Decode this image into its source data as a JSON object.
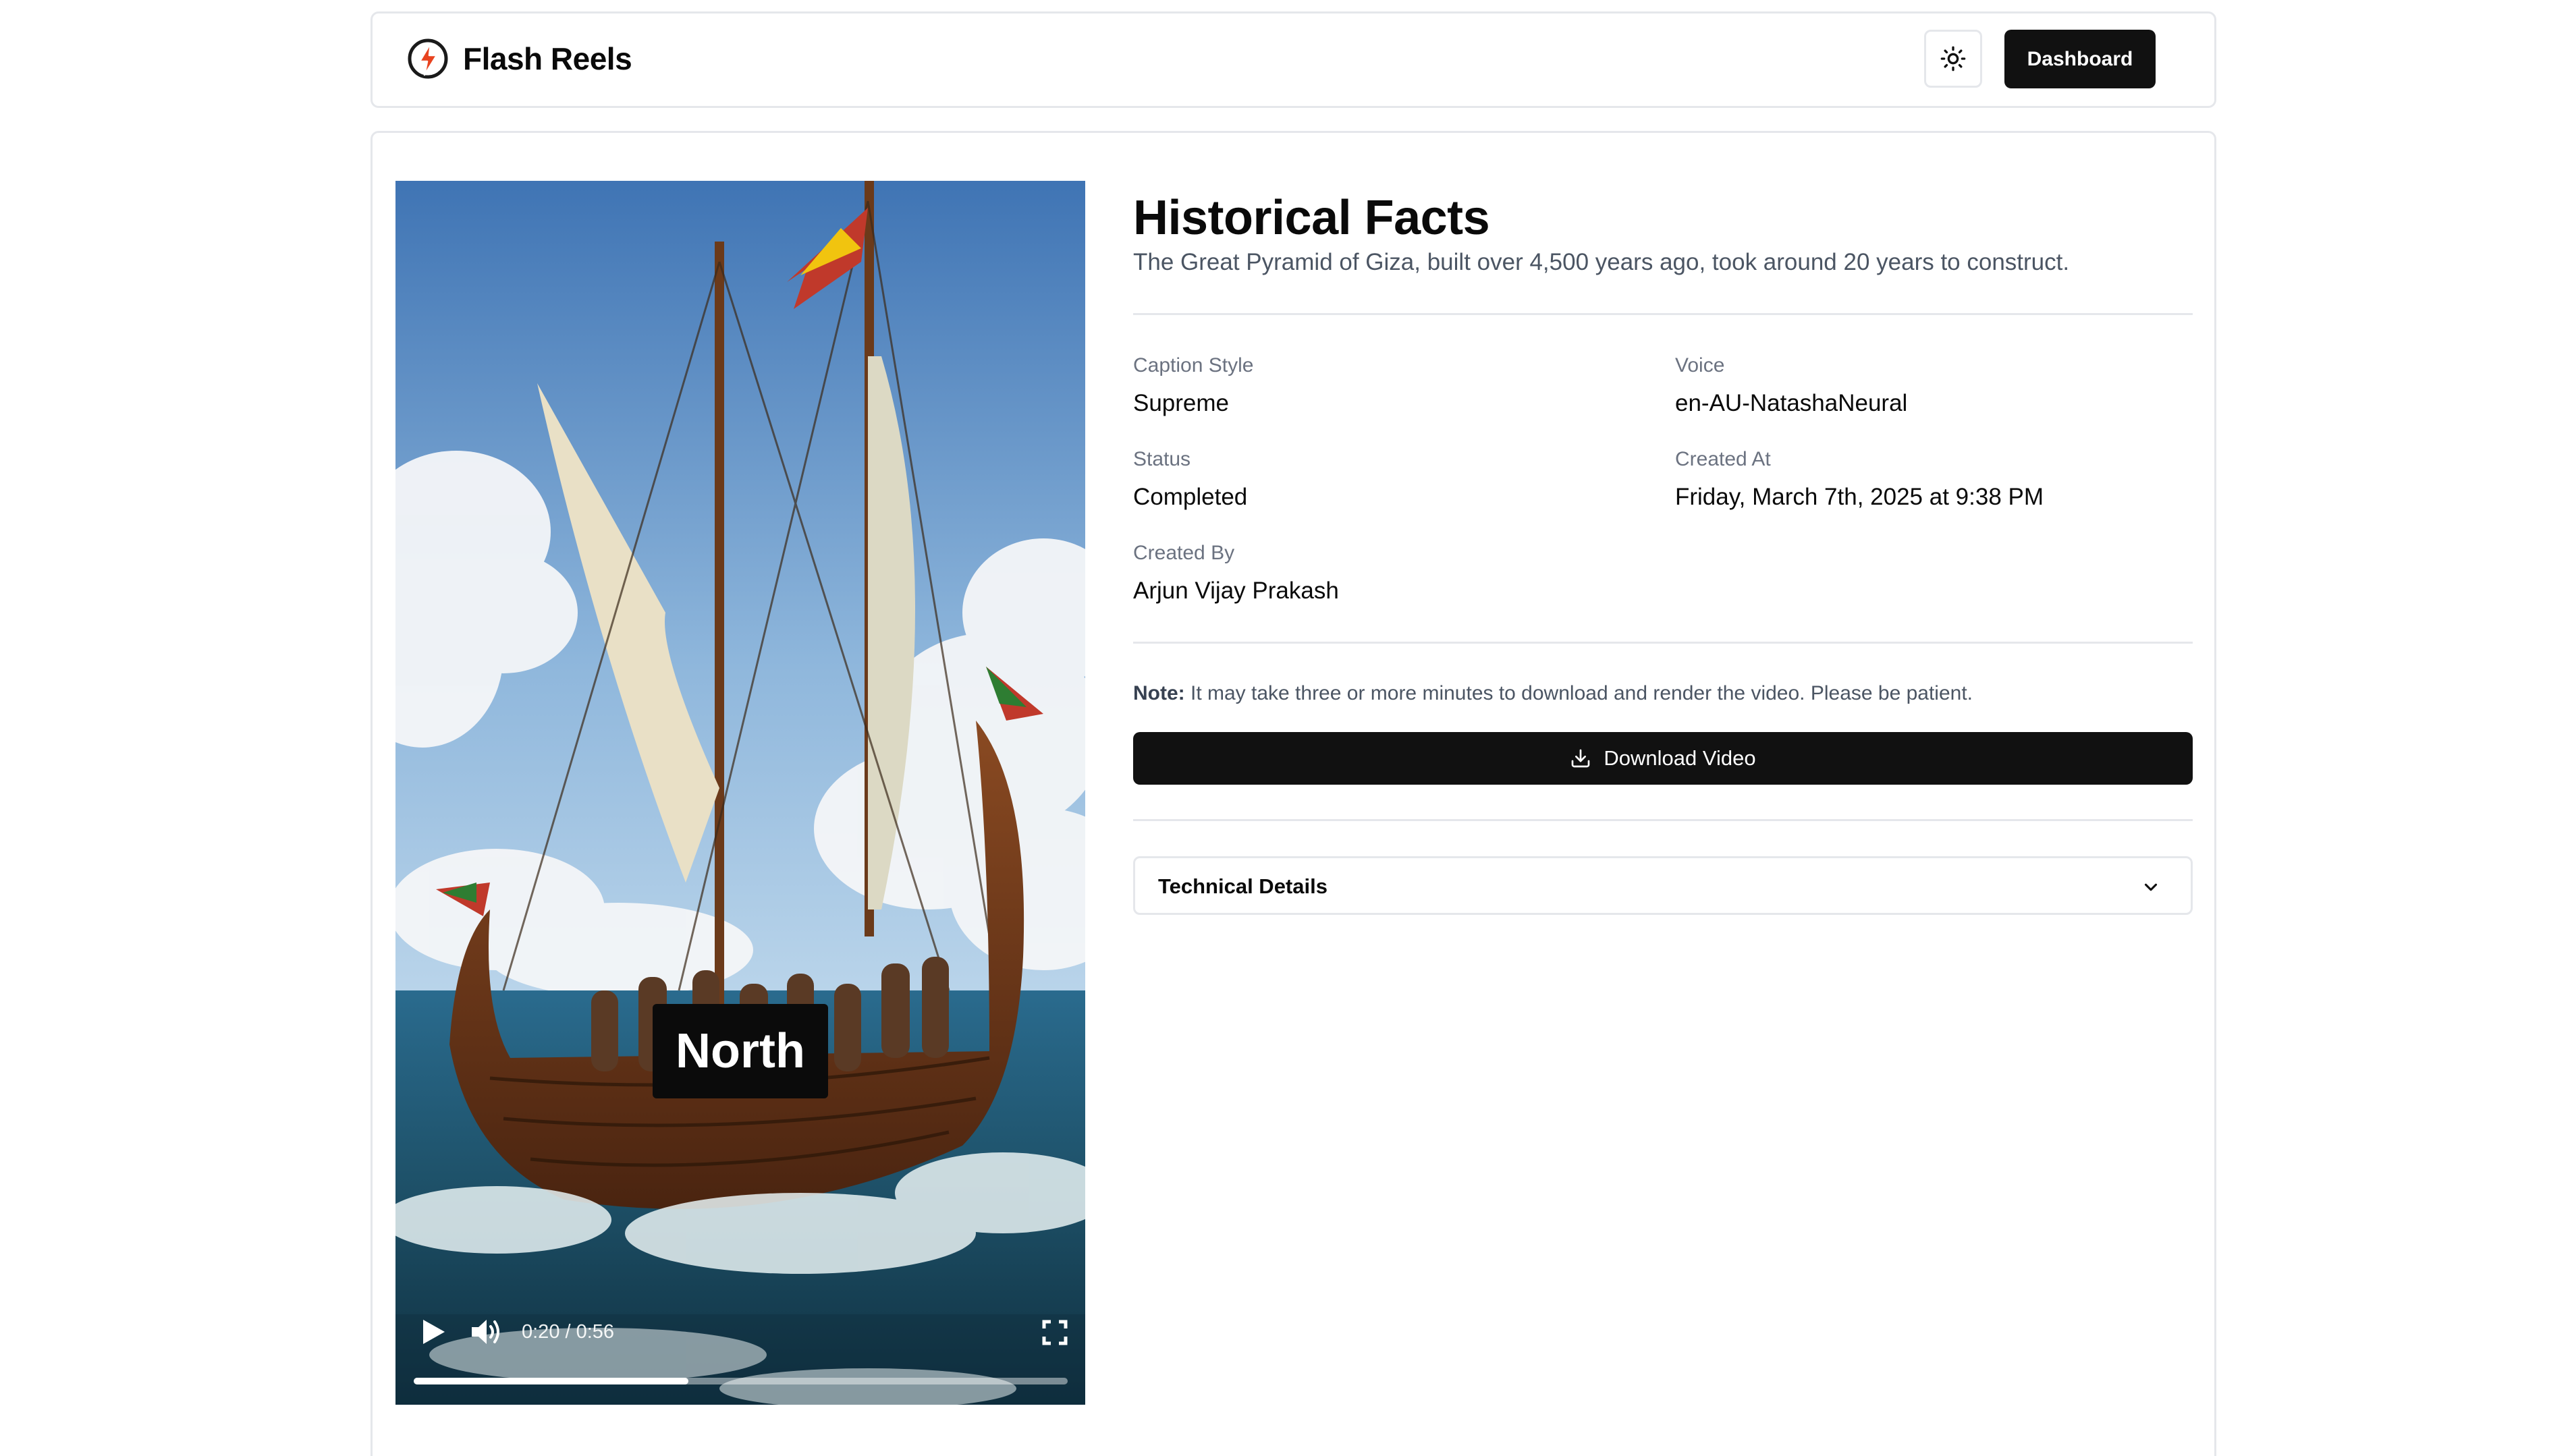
{
  "header": {
    "brand": "Flash Reels",
    "logo_icon": "lightning-bolt-icon",
    "theme_toggle_icon": "sun-icon",
    "dashboard_label": "Dashboard"
  },
  "video": {
    "caption_word": "North",
    "time": "0:20 / 0:56",
    "progress": 0.42,
    "controls": [
      "play-icon",
      "volume-icon",
      "fullscreen-icon"
    ]
  },
  "details": {
    "title": "Historical Facts",
    "subtitle": "The Great Pyramid of Giza, built over 4,500 years ago, took around 20 years to construct.",
    "fields": [
      {
        "label": "Caption Style",
        "value": "Supreme"
      },
      {
        "label": "Voice",
        "value": "en-AU-NatashaNeural"
      },
      {
        "label": "Status",
        "value": "Completed"
      },
      {
        "label": "Created At",
        "value": "Friday, March 7th, 2025 at 9:38 PM"
      },
      {
        "label": "Created By",
        "value": "Arjun Vijay Prakash"
      }
    ],
    "note_label": "Note:",
    "note_text": " It may take three or more minutes to download and render the video. Please be patient.",
    "download_label": "Download Video",
    "download_icon": "download-icon",
    "technical_details_label": "Technical Details",
    "accordion_icon": "chevron-down-icon"
  },
  "colors": {
    "primary_button": "#111111",
    "border": "#e5e7eb",
    "muted_text": "#6b7280",
    "brand_accent": "#e8431f"
  }
}
